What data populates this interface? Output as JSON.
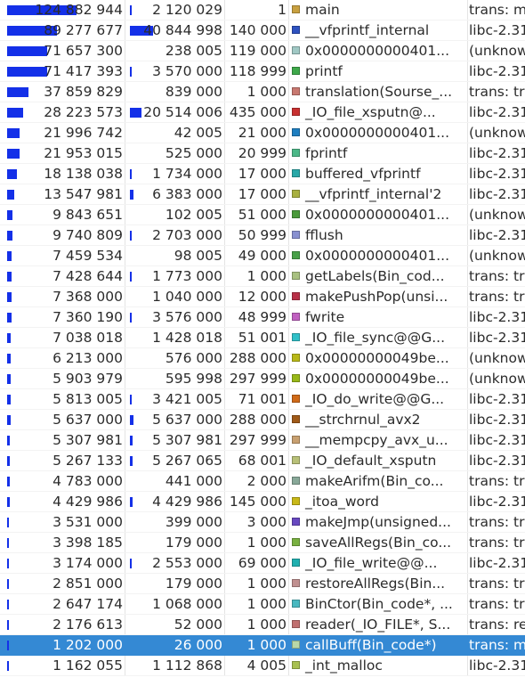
{
  "rows": [
    {
      "inclusive": "124 882 944",
      "inclusive_frac": 1.0,
      "self": "2 120 029",
      "self_frac": 0.017,
      "called": "1",
      "color": "#c8a040",
      "function": "main",
      "location": "trans: m"
    },
    {
      "inclusive": "89 277 677",
      "inclusive_frac": 0.715,
      "self": "40 844 998",
      "self_frac": 0.327,
      "called": "140 000",
      "color": "#2e52c0",
      "function": "__vfprintf_internal",
      "location": "libc-2.31"
    },
    {
      "inclusive": "71 657 300",
      "inclusive_frac": 0.574,
      "self": "238 005",
      "self_frac": 0.002,
      "called": "119 000",
      "color": "#a0c8c4",
      "function": "0x0000000000401...",
      "location": "(unknow"
    },
    {
      "inclusive": "71 417 393",
      "inclusive_frac": 0.572,
      "self": "3 570 000",
      "self_frac": 0.029,
      "called": "118 999",
      "color": "#3ea84a",
      "function": "printf",
      "location": "libc-2.31"
    },
    {
      "inclusive": "37 859 829",
      "inclusive_frac": 0.303,
      "self": "839 000",
      "self_frac": 0.007,
      "called": "1 000",
      "color": "#c87870",
      "function": "translation(Sourse_...",
      "location": "trans: tr"
    },
    {
      "inclusive": "28 223 573",
      "inclusive_frac": 0.226,
      "self": "20 514 006",
      "self_frac": 0.164,
      "called": "435 000",
      "color": "#c83030",
      "function": "_IO_file_xsputn@...",
      "location": "libc-2.31"
    },
    {
      "inclusive": "21 996 742",
      "inclusive_frac": 0.176,
      "self": "42 005",
      "self_frac": 0.0003,
      "called": "21 000",
      "color": "#1e7ec0",
      "function": "0x0000000000401...",
      "location": "(unknow"
    },
    {
      "inclusive": "21 953 015",
      "inclusive_frac": 0.176,
      "self": "525 000",
      "self_frac": 0.004,
      "called": "20 999",
      "color": "#4cb888",
      "function": "fprintf",
      "location": "libc-2.31"
    },
    {
      "inclusive": "18 138 038",
      "inclusive_frac": 0.145,
      "self": "1 734 000",
      "self_frac": 0.014,
      "called": "17 000",
      "color": "#28a8a8",
      "function": "buffered_vfprintf",
      "location": "libc-2.31"
    },
    {
      "inclusive": "13 547 981",
      "inclusive_frac": 0.108,
      "self": "6 383 000",
      "self_frac": 0.051,
      "called": "17 000",
      "color": "#a8b040",
      "function": "__vfprintf_internal'2",
      "location": "libc-2.31"
    },
    {
      "inclusive": "9 843 651",
      "inclusive_frac": 0.079,
      "self": "102 005",
      "self_frac": 0.0008,
      "called": "51 000",
      "color": "#4a9a3a",
      "function": "0x0000000000401...",
      "location": "(unknow"
    },
    {
      "inclusive": "9 740 809",
      "inclusive_frac": 0.078,
      "self": "2 703 000",
      "self_frac": 0.022,
      "called": "50 999",
      "color": "#8890d0",
      "function": "fflush",
      "location": "libc-2.31"
    },
    {
      "inclusive": "7 459 534",
      "inclusive_frac": 0.06,
      "self": "98 005",
      "self_frac": 0.0008,
      "called": "49 000",
      "color": "#48a048",
      "function": "0x0000000000401...",
      "location": "(unknow"
    },
    {
      "inclusive": "7 428 644",
      "inclusive_frac": 0.059,
      "self": "1 773 000",
      "self_frac": 0.014,
      "called": "1 000",
      "color": "#a8c080",
      "function": "getLabels(Bin_cod...",
      "location": "trans: tr"
    },
    {
      "inclusive": "7 368 000",
      "inclusive_frac": 0.059,
      "self": "1 040 000",
      "self_frac": 0.008,
      "called": "12 000",
      "color": "#b83048",
      "function": "makePushPop(unsi...",
      "location": "trans: tr"
    },
    {
      "inclusive": "7 360 190",
      "inclusive_frac": 0.059,
      "self": "3 576 000",
      "self_frac": 0.029,
      "called": "48 999",
      "color": "#c060c0",
      "function": "fwrite",
      "location": "libc-2.31"
    },
    {
      "inclusive": "7 038 018",
      "inclusive_frac": 0.056,
      "self": "1 428 018",
      "self_frac": 0.011,
      "called": "51 001",
      "color": "#30c0c8",
      "function": "_IO_file_sync@@G...",
      "location": "libc-2.31"
    },
    {
      "inclusive": "6 213 000",
      "inclusive_frac": 0.05,
      "self": "576 000",
      "self_frac": 0.005,
      "called": "288 000",
      "color": "#b8b818",
      "function": "0x00000000049be...",
      "location": "(unknow"
    },
    {
      "inclusive": "5 903 979",
      "inclusive_frac": 0.047,
      "self": "595 998",
      "self_frac": 0.005,
      "called": "297 999",
      "color": "#98b818",
      "function": "0x00000000049be...",
      "location": "(unknow"
    },
    {
      "inclusive": "5 813 005",
      "inclusive_frac": 0.047,
      "self": "3 421 005",
      "self_frac": 0.027,
      "called": "71 001",
      "color": "#d06a18",
      "function": "_IO_do_write@@G...",
      "location": "libc-2.31"
    },
    {
      "inclusive": "5 637 000",
      "inclusive_frac": 0.045,
      "self": "5 637 000",
      "self_frac": 0.045,
      "called": "288 000",
      "color": "#a05a18",
      "function": "__strchrnul_avx2",
      "location": "libc-2.31"
    },
    {
      "inclusive": "5 307 981",
      "inclusive_frac": 0.043,
      "self": "5 307 981",
      "self_frac": 0.043,
      "called": "297 999",
      "color": "#c8a070",
      "function": "__mempcpy_avx_u...",
      "location": "libc-2.31"
    },
    {
      "inclusive": "5 267 133",
      "inclusive_frac": 0.042,
      "self": "5 267 065",
      "self_frac": 0.042,
      "called": "68 001",
      "color": "#b8c078",
      "function": "_IO_default_xsputn",
      "location": "libc-2.31"
    },
    {
      "inclusive": "4 783 000",
      "inclusive_frac": 0.038,
      "self": "441 000",
      "self_frac": 0.004,
      "called": "2 000",
      "color": "#88a898",
      "function": "makeArifm(Bin_co...",
      "location": "trans: tr"
    },
    {
      "inclusive": "4 429 986",
      "inclusive_frac": 0.035,
      "self": "4 429 986",
      "self_frac": 0.035,
      "called": "145 000",
      "color": "#c8b818",
      "function": "_itoa_word",
      "location": "libc-2.31"
    },
    {
      "inclusive": "3 531 000",
      "inclusive_frac": 0.028,
      "self": "399 000",
      "self_frac": 0.003,
      "called": "3 000",
      "color": "#6848c0",
      "function": "makeJmp(unsigned...",
      "location": "trans: tr"
    },
    {
      "inclusive": "3 398 185",
      "inclusive_frac": 0.027,
      "self": "179 000",
      "self_frac": 0.001,
      "called": "1 000",
      "color": "#78b040",
      "function": "saveAllRegs(Bin_co...",
      "location": "trans: tr"
    },
    {
      "inclusive": "3 174 000",
      "inclusive_frac": 0.025,
      "self": "2 553 000",
      "self_frac": 0.02,
      "called": "69 000",
      "color": "#20b0b0",
      "function": "_IO_file_write@@...",
      "location": "libc-2.31"
    },
    {
      "inclusive": "2 851 000",
      "inclusive_frac": 0.023,
      "self": "179 000",
      "self_frac": 0.001,
      "called": "1 000",
      "color": "#c09090",
      "function": "restoreAllRegs(Bin...",
      "location": "trans: tr"
    },
    {
      "inclusive": "2 647 174",
      "inclusive_frac": 0.021,
      "self": "1 068 000",
      "self_frac": 0.009,
      "called": "1 000",
      "color": "#48b8c0",
      "function": "BinCtor(Bin_code*, ...",
      "location": "trans: tr"
    },
    {
      "inclusive": "2 176 613",
      "inclusive_frac": 0.017,
      "self": "52 000",
      "self_frac": 0.0004,
      "called": "1 000",
      "color": "#c07070",
      "function": "reader(_IO_FILE*, S...",
      "location": "trans: re"
    },
    {
      "inclusive": "1 202 000",
      "inclusive_frac": 0.01,
      "self": "26 000",
      "self_frac": 0.0002,
      "called": "1 000",
      "color": "#b8d8a8",
      "function": "callBuff(Bin_code*)",
      "location": "trans: m",
      "selected": true
    },
    {
      "inclusive": "1 162 055",
      "inclusive_frac": 0.009,
      "self": "1 112 868",
      "self_frac": 0.009,
      "called": "4 005",
      "color": "#a8c050",
      "function": "_int_malloc",
      "location": "libc-2.31"
    }
  ]
}
